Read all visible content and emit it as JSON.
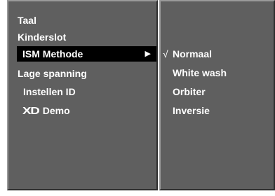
{
  "menu": {
    "items": [
      {
        "label": "Taal"
      },
      {
        "label": "Kinderslot"
      },
      {
        "label": "ISM Methode"
      },
      {
        "label": "Lage spanning"
      },
      {
        "label": "Instellen ID"
      },
      {
        "label": "Demo",
        "icon_text": "XD"
      }
    ],
    "selected_index": 2,
    "submenu_arrow": "▶"
  },
  "submenu": {
    "check_mark": "√",
    "items": [
      {
        "label": "Normaal",
        "checked": true
      },
      {
        "label": "White wash",
        "checked": false
      },
      {
        "label": "Orbiter",
        "checked": false
      },
      {
        "label": "Inversie",
        "checked": false
      }
    ]
  },
  "colors": {
    "panel": "#5f5f5f",
    "selected": "#000000",
    "text": "#ffffff"
  }
}
